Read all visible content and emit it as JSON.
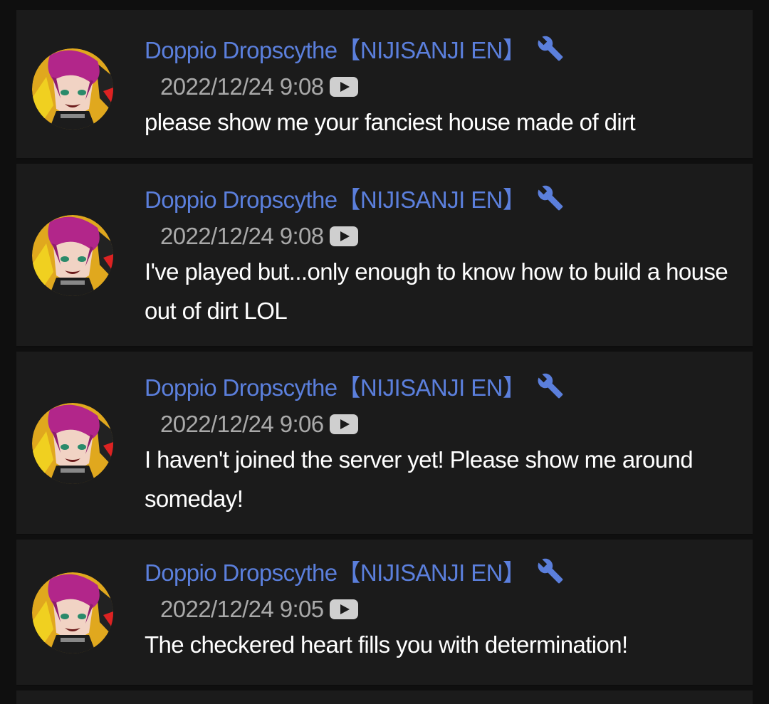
{
  "comments": [
    {
      "author": "Doppio Dropscythe【NIJISANJI EN】",
      "timestamp": "2022/12/24 9:08",
      "message": "please show me your fanciest house made of dirt"
    },
    {
      "author": "Doppio Dropscythe【NIJISANJI EN】",
      "timestamp": "2022/12/24 9:08",
      "message": "I've played but...only enough to know how to build a house out of dirt LOL"
    },
    {
      "author": "Doppio Dropscythe【NIJISANJI EN】",
      "timestamp": "2022/12/24 9:06",
      "message": "I haven't joined the server yet! Please show me around someday!"
    },
    {
      "author": "Doppio Dropscythe【NIJISANJI EN】",
      "timestamp": "2022/12/24 9:05",
      "message": "The checkered heart fills you with determination!"
    }
  ],
  "icons": {
    "badge": "wrench-icon",
    "source": "youtube-play-icon",
    "avatar": "avatar-image"
  },
  "colors": {
    "background": "#0f0f0f",
    "card": "#1b1b1b",
    "author": "#5b7fdc",
    "timestamp": "#a9a9a9",
    "message": "#ffffff",
    "wrench": "#5b7fdc"
  }
}
